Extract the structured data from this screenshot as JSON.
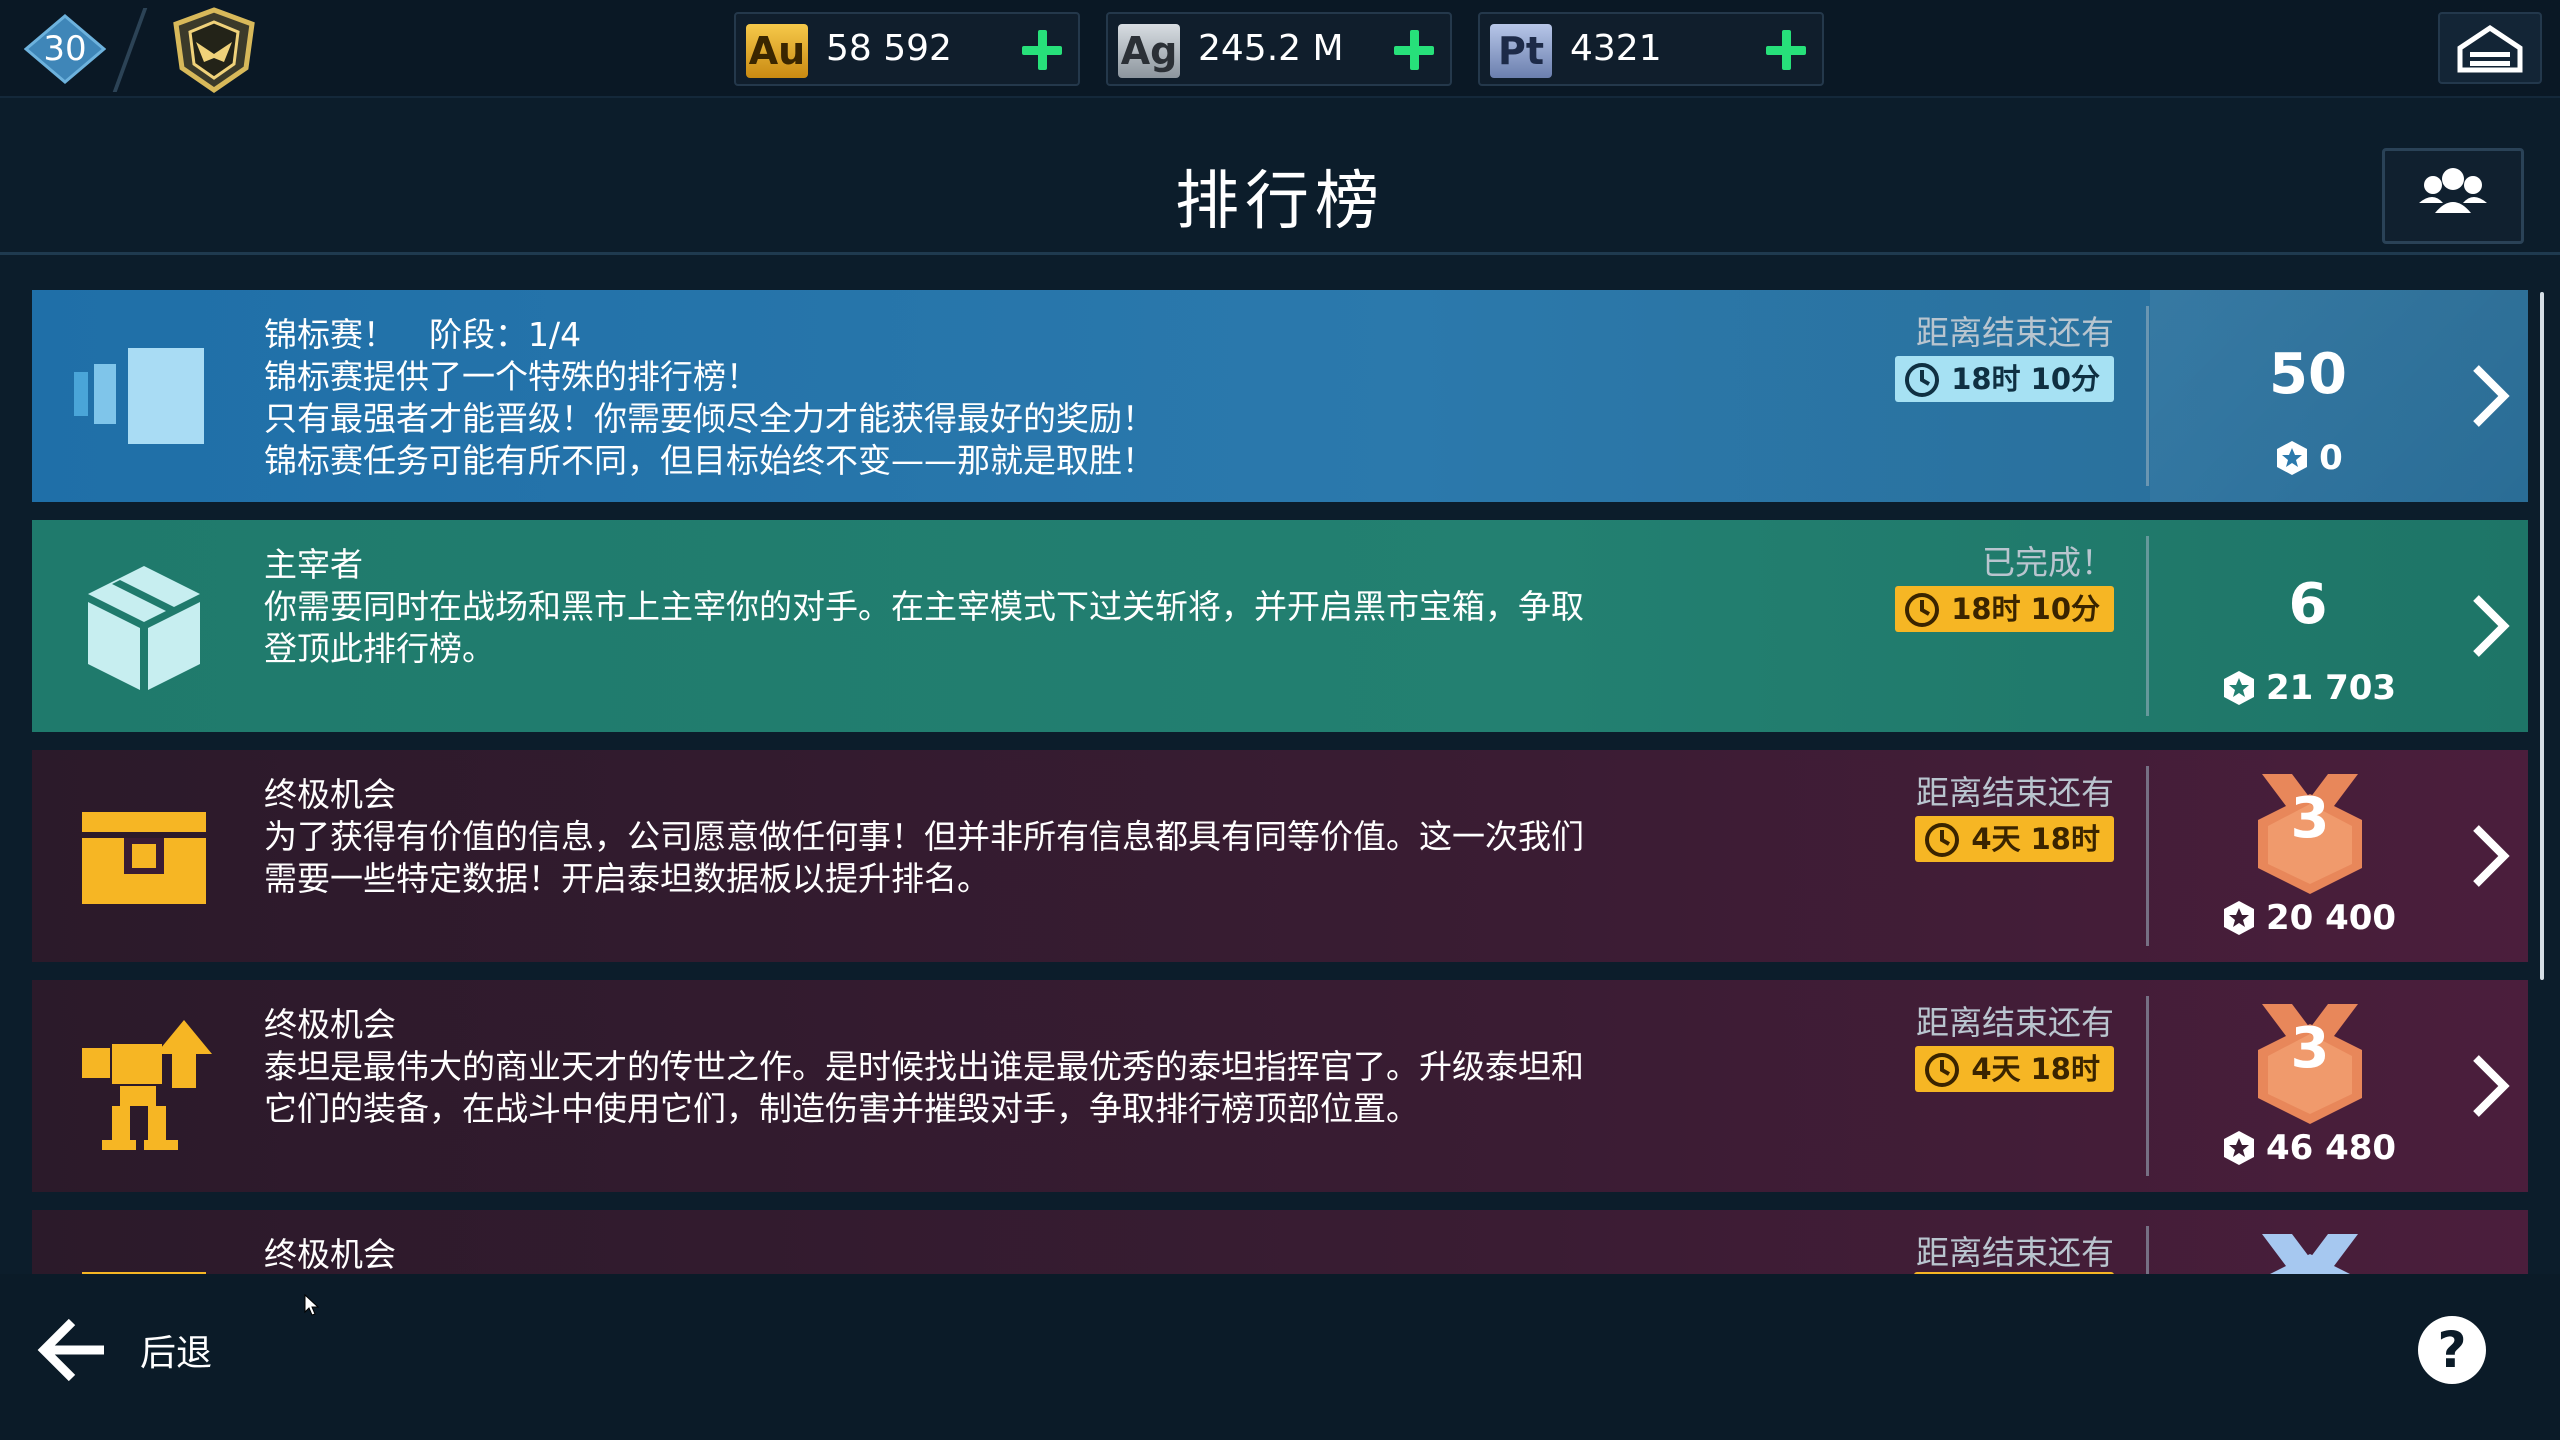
{
  "topbar": {
    "level": "30",
    "currencies": [
      {
        "code": "Au",
        "value": "58 592"
      },
      {
        "code": "Ag",
        "value": "245.2 M"
      },
      {
        "code": "Pt",
        "value": "4321"
      }
    ]
  },
  "header": {
    "title": "排行榜"
  },
  "cards": [
    {
      "title": "锦标赛！　阶段：1/4",
      "desc": [
        "锦标赛提供了一个特殊的排行榜！",
        "只有最强者才能晋级！你需要倾尽全力才能获得最好的奖励！",
        "锦标赛任务可能有所不同，但目标始终不变——那就是取胜！"
      ],
      "status": "距离结束还有",
      "timer": "18时 10分",
      "rank": "50",
      "score": "0",
      "icon": "tournament-icon"
    },
    {
      "title": "主宰者",
      "desc": [
        "你需要同时在战场和黑市上主宰你的对手。在主宰模式下过关斩将，并开启黑市宝箱，争取",
        "登顶此排行榜。"
      ],
      "status": "已完成！",
      "timer": "18时 10分",
      "rank": "6",
      "score": "21 703",
      "icon": "cube-icon"
    },
    {
      "title": "终极机会",
      "desc": [
        "为了获得有价值的信息，公司愿意做任何事！但并非所有信息都具有同等价值。这一次我们",
        "需要一些特定数据！开启泰坦数据板以提升排名。"
      ],
      "status": "距离结束还有",
      "timer": "4天 18时",
      "rank": "3",
      "score": "20 400",
      "icon": "datapad-chest-icon"
    },
    {
      "title": "终极机会",
      "desc": [
        "泰坦是最伟大的商业天才的传世之作。是时候找出谁是最优秀的泰坦指挥官了。升级泰坦和",
        "它们的装备，在战斗中使用它们，制造伤害并摧毁对手，争取排行榜顶部位置。"
      ],
      "status": "距离结束还有",
      "timer": "4天 18时",
      "rank": "3",
      "score": "46 480",
      "icon": "titan-upgrade-icon"
    },
    {
      "title": "终极机会",
      "status": "距离结束还有",
      "icon": "chest-icon"
    }
  ],
  "footer": {
    "back_label": "后退",
    "help": "?"
  },
  "colors": {
    "accent_green": "#27e07a",
    "timer_blue": "#a6e1f3",
    "timer_yellow": "#f6b624",
    "medal_bronze": "#e8875a"
  }
}
